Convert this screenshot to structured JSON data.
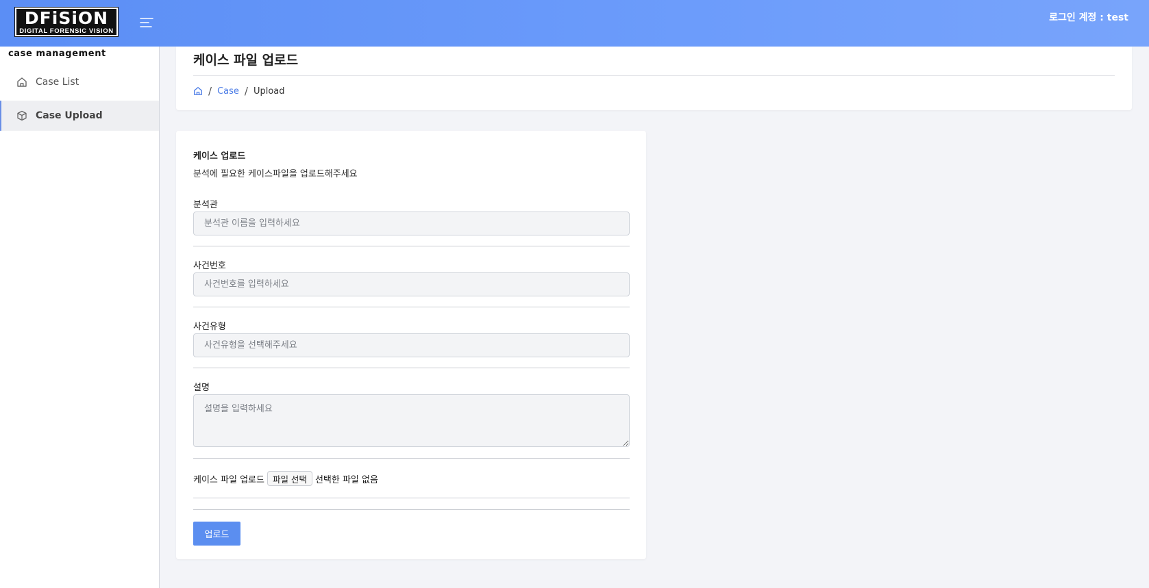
{
  "header": {
    "logo_main": "DFiSiON",
    "logo_sub": "DIGITAL FORENSIC VISION",
    "user_label": "로그인 계정 : test"
  },
  "sidebar": {
    "title": "case management",
    "items": [
      {
        "label": "Case List",
        "icon": "home-icon",
        "active": false
      },
      {
        "label": "Case Upload",
        "icon": "box-icon",
        "active": true
      }
    ]
  },
  "page": {
    "title": "케이스 파일 업로드",
    "breadcrumb": {
      "link": "Case",
      "current": "Upload"
    }
  },
  "form": {
    "title": "케이스 업로드",
    "description": "분석에 필요한 케이스파일을 업로드해주세요",
    "fields": {
      "analyst": {
        "label": "분석관",
        "placeholder": "분석관 이름을 입력하세요",
        "value": ""
      },
      "case_number": {
        "label": "사건번호",
        "placeholder": "사건번호를 입력하세요",
        "value": ""
      },
      "case_type": {
        "label": "사건유형",
        "placeholder": "사건유형을 선택해주세요",
        "value": ""
      },
      "description": {
        "label": "설명",
        "placeholder": "설명을 입력하세요",
        "value": ""
      }
    },
    "file": {
      "label": "케이스 파일 업로드",
      "button": "파일 선택",
      "status": "선택한 파일 없음"
    },
    "submit_label": "업로드"
  },
  "colors": {
    "topbar": "#5b8ef5",
    "accent": "#4a7be6",
    "button": "#5b8ef0"
  }
}
